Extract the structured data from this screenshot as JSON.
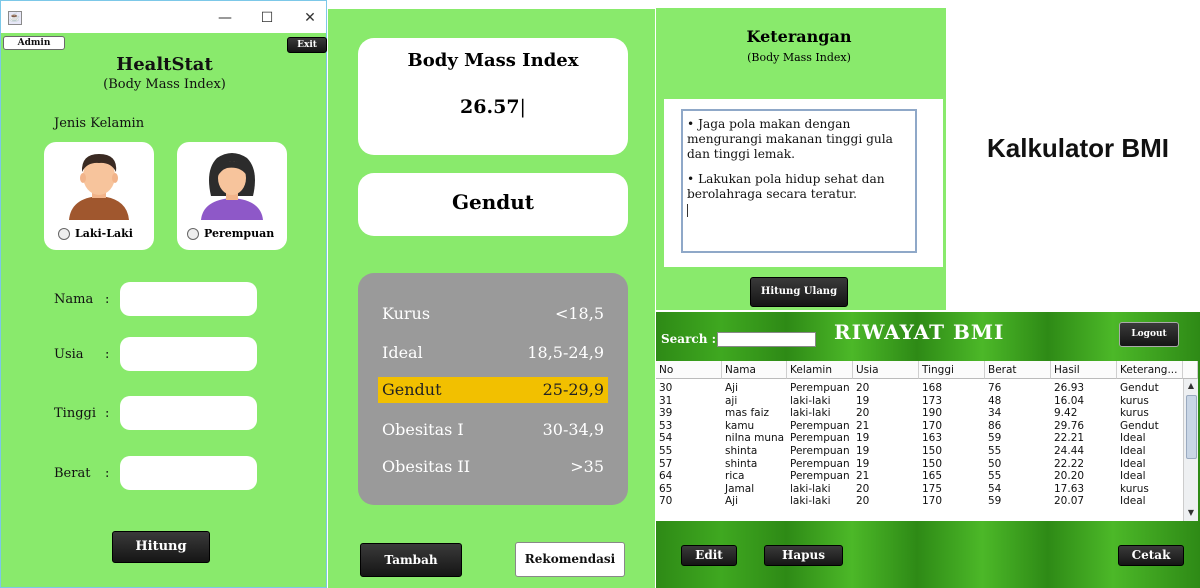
{
  "window": {
    "icon": "java-icon",
    "minimize": "—",
    "maximize": "☐",
    "close": "✕"
  },
  "form": {
    "admin_label": "Admin",
    "exit_label": "Exit",
    "title": "HealtStat",
    "subtitle": "(Body Mass Index)",
    "gender_label": "Jenis Kelamin",
    "male_label": "Laki-Laki",
    "female_label": "Perempuan",
    "fields": {
      "nama": {
        "label": "Nama",
        "colon": ":",
        "value": ""
      },
      "usia": {
        "label": "Usia",
        "colon": ":",
        "value": ""
      },
      "tinggi": {
        "label": "Tinggi",
        "colon": ":",
        "value": ""
      },
      "berat": {
        "label": "Berat",
        "colon": ":",
        "value": ""
      }
    },
    "hitung_label": "Hitung"
  },
  "result": {
    "title": "Body Mass Index",
    "bmi_value": "26.57",
    "category": "Gendut",
    "ranges": [
      {
        "name": "Kurus",
        "value": "<18,5",
        "highlighted": false
      },
      {
        "name": "Ideal",
        "value": "18,5-24,9",
        "highlighted": false
      },
      {
        "name": "Gendut",
        "value": "25-29,9",
        "highlighted": true
      },
      {
        "name": "Obesitas  I",
        "value": "30-34,9",
        "highlighted": false
      },
      {
        "name": "Obesitas II",
        "value": ">35",
        "highlighted": false
      }
    ],
    "highlight_color": "#f2c000",
    "tambah_label": "Tambah",
    "rekomendasi_label": "Rekomendasi"
  },
  "keterangan": {
    "title": "Keterangan",
    "subtitle": "(Body Mass Index)",
    "tips": [
      "• Jaga pola makan dengan mengurangi makanan tinggi gula dan tinggi lemak.",
      "• Lakukan pola hidup sehat dan berolahraga secara teratur."
    ],
    "hitung_ulang_label": "Hitung Ulang"
  },
  "caption": "Kalkulator BMI",
  "riwayat": {
    "search_label": "Search :",
    "search_value": "",
    "title": "RIWAYAT BMI",
    "logout_label": "Logout",
    "columns": [
      "No",
      "Nama",
      "Kelamin",
      "Usia",
      "Tinggi",
      "Berat",
      "Hasil",
      "Keterang..."
    ],
    "rows": [
      [
        "30",
        "Aji",
        "Perempuan",
        "20",
        "168",
        "76",
        "26.93",
        "Gendut"
      ],
      [
        "31",
        "aji",
        "laki-laki",
        "19",
        "173",
        "48",
        "16.04",
        "kurus"
      ],
      [
        "39",
        "mas faiz",
        "laki-laki",
        "20",
        "190",
        "34",
        "9.42",
        "kurus"
      ],
      [
        "53",
        "kamu",
        "Perempuan",
        "21",
        "170",
        "86",
        "29.76",
        "Gendut"
      ],
      [
        "54",
        "niIna muna",
        "Perempuan",
        "19",
        "163",
        "59",
        "22.21",
        "Ideal"
      ],
      [
        "55",
        "shinta",
        "Perempuan",
        "19",
        "150",
        "55",
        "24.44",
        "Ideal"
      ],
      [
        "57",
        "shinta",
        "Perempuan",
        "19",
        "150",
        "50",
        "22.22",
        "Ideal"
      ],
      [
        "64",
        "rica",
        "Perempuan",
        "21",
        "165",
        "55",
        "20.20",
        "Ideal"
      ],
      [
        "65",
        "Jamal",
        "laki-laki",
        "20",
        "175",
        "54",
        "17.63",
        "kurus"
      ],
      [
        "70",
        "Aji",
        "laki-laki",
        "20",
        "170",
        "59",
        "20.07",
        "Ideal"
      ]
    ],
    "edit_label": "Edit",
    "hapus_label": "Hapus",
    "cetak_label": "Cetak"
  },
  "colors": {
    "panel_green": "#89ea6c",
    "range_gray": "#9a9a9a",
    "dark_button": "#1a1a1a"
  }
}
